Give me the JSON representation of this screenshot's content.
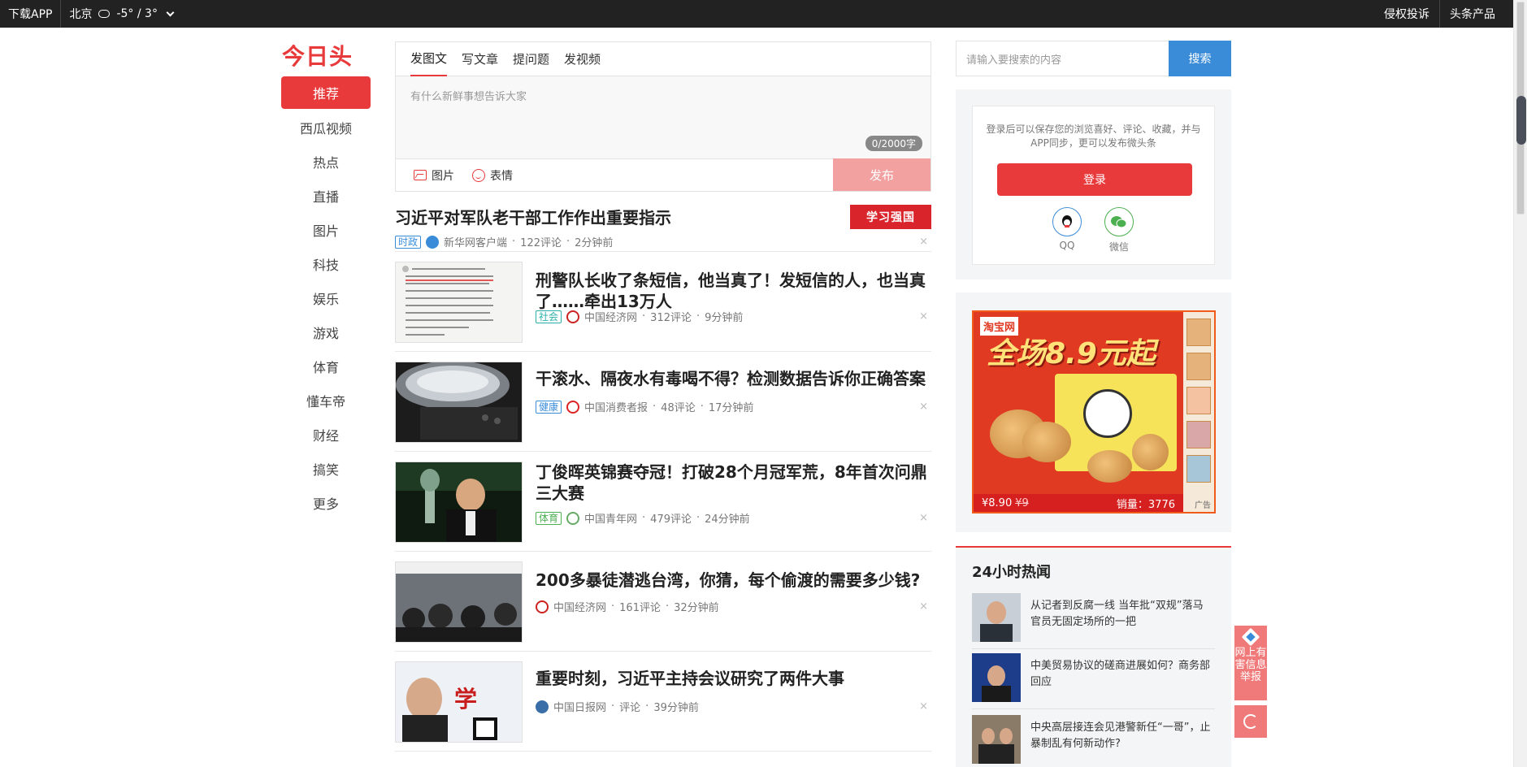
{
  "topbar": {
    "download_app": "下载APP",
    "city": "北京",
    "temp": "-5° / 3°",
    "links": [
      "侵权投诉",
      "头条产品"
    ]
  },
  "logo": "今日头条",
  "nav": {
    "items": [
      "推荐",
      "西瓜视频",
      "热点",
      "直播",
      "图片",
      "科技",
      "娱乐",
      "游戏",
      "体育",
      "懂车帝",
      "财经",
      "搞笑",
      "更多"
    ]
  },
  "publish": {
    "tabs": [
      "发图文",
      "写文章",
      "提问题",
      "发视频"
    ],
    "placeholder": "有什么新鲜事想告诉大家",
    "counter": "0/2000字",
    "image_label": "图片",
    "emoji_label": "表情",
    "submit_label": "发布"
  },
  "feed": {
    "top": {
      "title": "习近平对军队老干部工作作出重要指示",
      "badge": "学习强国",
      "tag": "时政",
      "source": "新华网客户端",
      "comments": "122评论",
      "time": "2分钟前"
    },
    "items": [
      {
        "title": "刑警队长收了条短信，他当真了！发短信的人，也当真了……牵出13万人",
        "tag": "社会",
        "source": "中国经济网",
        "comments": "312评论",
        "time": "9分钟前"
      },
      {
        "title": "干滚水、隔夜水有毒喝不得？检测数据告诉你正确答案",
        "tag": "健康",
        "source": "中国消费者报",
        "comments": "48评论",
        "time": "17分钟前"
      },
      {
        "title": "丁俊晖英锦赛夺冠！打破28个月冠军荒，8年首次问鼎三大赛",
        "tag": "体育",
        "source": "中国青年网",
        "comments": "479评论",
        "time": "24分钟前"
      },
      {
        "title": "200多暴徒潜逃台湾，你猜，每个偷渡的需要多少钱?",
        "tag": "",
        "source": "中国经济网",
        "comments": "161评论",
        "time": "32分钟前"
      },
      {
        "title": "重要时刻，习近平主持会议研究了两件大事",
        "tag": "",
        "source": "中国日报网",
        "comments": "评论",
        "time": "39分钟前"
      }
    ],
    "close_glyph": "×"
  },
  "search": {
    "placeholder": "请输入要搜索的内容",
    "button": "搜索"
  },
  "login": {
    "text": "登录后可以保存您的浏览喜好、评论、收藏，并与APP同步，更可以发布微头条",
    "button": "登录",
    "qq": "QQ",
    "wechat": "微信"
  },
  "ad": {
    "brand": "淘宝网",
    "headline": "全场8.9元起",
    "price": "¥8.90",
    "old_price": "¥9",
    "sales": "销量：3776",
    "tag": "广告"
  },
  "hot": {
    "title": "24小时热闻",
    "items": [
      "从记者到反腐一线 当年批“双规”落马官员无固定场所的一把",
      "中美贸易协议的磋商进展如何？商务部回应",
      "中央高层接连会见港警新任“一哥”，止暴制乱有何新动作?"
    ]
  },
  "float": {
    "report": "网上有害信息举报"
  },
  "colors": {
    "brand_red": "#e8393b",
    "search_blue": "#3a8cd8"
  }
}
